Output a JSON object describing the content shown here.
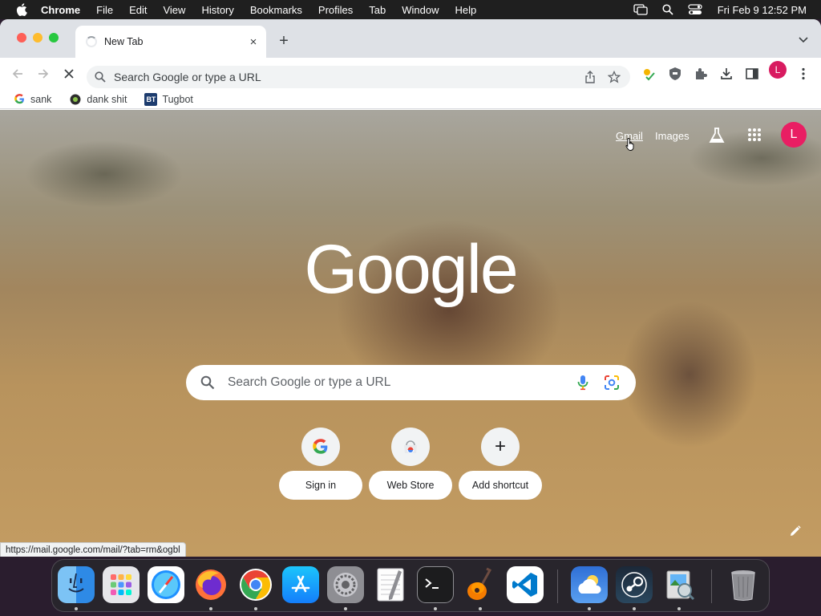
{
  "menubar": {
    "app_name": "Chrome",
    "items": [
      "File",
      "Edit",
      "View",
      "History",
      "Bookmarks",
      "Profiles",
      "Tab",
      "Window",
      "Help"
    ],
    "clock": "Fri Feb 9  12:52 PM",
    "status_icons": [
      "screen-mirroring-icon",
      "spotlight-search-icon",
      "control-center-icon"
    ]
  },
  "browser": {
    "tab": {
      "title": "New Tab",
      "close_label": "×",
      "loading": true
    },
    "new_tab_label": "+",
    "omnibox": {
      "placeholder": "Search Google or type a URL"
    },
    "profile_initial": "L",
    "toolbar_icons": [
      "share-icon",
      "bookmark-star-icon",
      "extension-colorful-icon",
      "shield-extension-icon",
      "puzzle-extensions-icon",
      "download-icon",
      "side-panel-icon",
      "kebab-menu-icon"
    ]
  },
  "bookmarks": [
    {
      "label": "sank",
      "icon": "google-g-icon"
    },
    {
      "label": "dank shit",
      "icon": "bookmark-favicon-icon"
    },
    {
      "label": "Tugbot",
      "icon": "bt-favicon-icon",
      "icon_text": "BT"
    }
  ],
  "ntp": {
    "links": {
      "gmail": "Gmail",
      "images": "Images"
    },
    "avatar_initial": "L",
    "logo": "Google",
    "search_placeholder": "Search Google or type a URL",
    "shortcuts": [
      {
        "label": "Sign in",
        "icon": "google-g-icon"
      },
      {
        "label": "Web Store",
        "icon": "web-store-icon"
      },
      {
        "label": "Add shortcut",
        "icon": "plus-icon",
        "symbol": "+"
      }
    ],
    "status_url": "https://mail.google.com/mail/?tab=rm&ogbl"
  },
  "dock": {
    "apps": [
      "Finder",
      "Launchpad",
      "Safari",
      "Firefox",
      "Google Chrome",
      "App Store",
      "System Settings",
      "TextEdit",
      "Terminal",
      "GarageBand",
      "Visual Studio Code",
      "Weather",
      "Steam",
      "Preview",
      "Trash"
    ]
  },
  "colors": {
    "menubar_bg": "#1f1f1f",
    "tabstrip_bg": "#dee1e6",
    "omnibox_bg": "#f1f3f4",
    "avatar_pink": "#e91e63",
    "traffic_red": "#fe5f57",
    "traffic_yellow": "#febc2e",
    "traffic_green": "#28c840"
  }
}
